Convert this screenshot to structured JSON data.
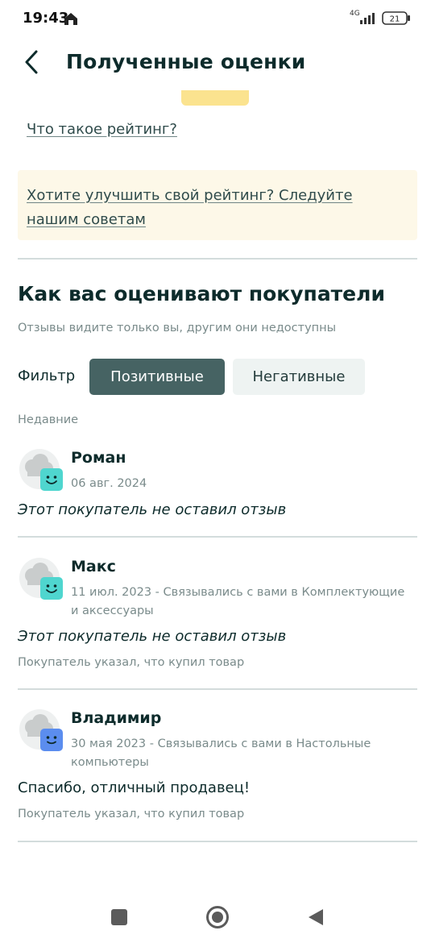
{
  "status_bar": {
    "time": "19:43",
    "network": "4G",
    "battery": "21"
  },
  "header": {
    "title": "Полученные оценки"
  },
  "rating_link": "Что такое рейтинг?",
  "tip": {
    "text": "Хотите улучшить свой рейтинг? Следуйте нашим советам"
  },
  "section": {
    "title": "Как вас оценивают покупатели",
    "subtitle": "Отзывы видите только вы, другим они недоступны"
  },
  "filter": {
    "label": "Фильтр",
    "options": [
      "Позитивные",
      "Негативные"
    ],
    "selected": "Позитивные"
  },
  "recent_label": "Недавние",
  "reviews": [
    {
      "name": "Роман",
      "meta": "06 авг. 2024",
      "comment": "Этот покупатель не оставил отзыв",
      "badge_color": "#4fd6cf"
    },
    {
      "name": "Макс",
      "meta": "11 июл. 2023 - Связывались с вами в Комплектующие и аксессуары",
      "comment": "Этот покупатель не оставил отзыв",
      "bought": "Покупатель указал, что купил товар",
      "badge_color": "#4fd6cf"
    },
    {
      "name": "Владимир",
      "meta": "30 мая 2023 - Связывались с вами в Настольные компьютеры",
      "comment": "Спасибо, отличный продавец!",
      "bought": "Покупатель указал, что купил товар",
      "badge_color": "#5b8def"
    }
  ]
}
